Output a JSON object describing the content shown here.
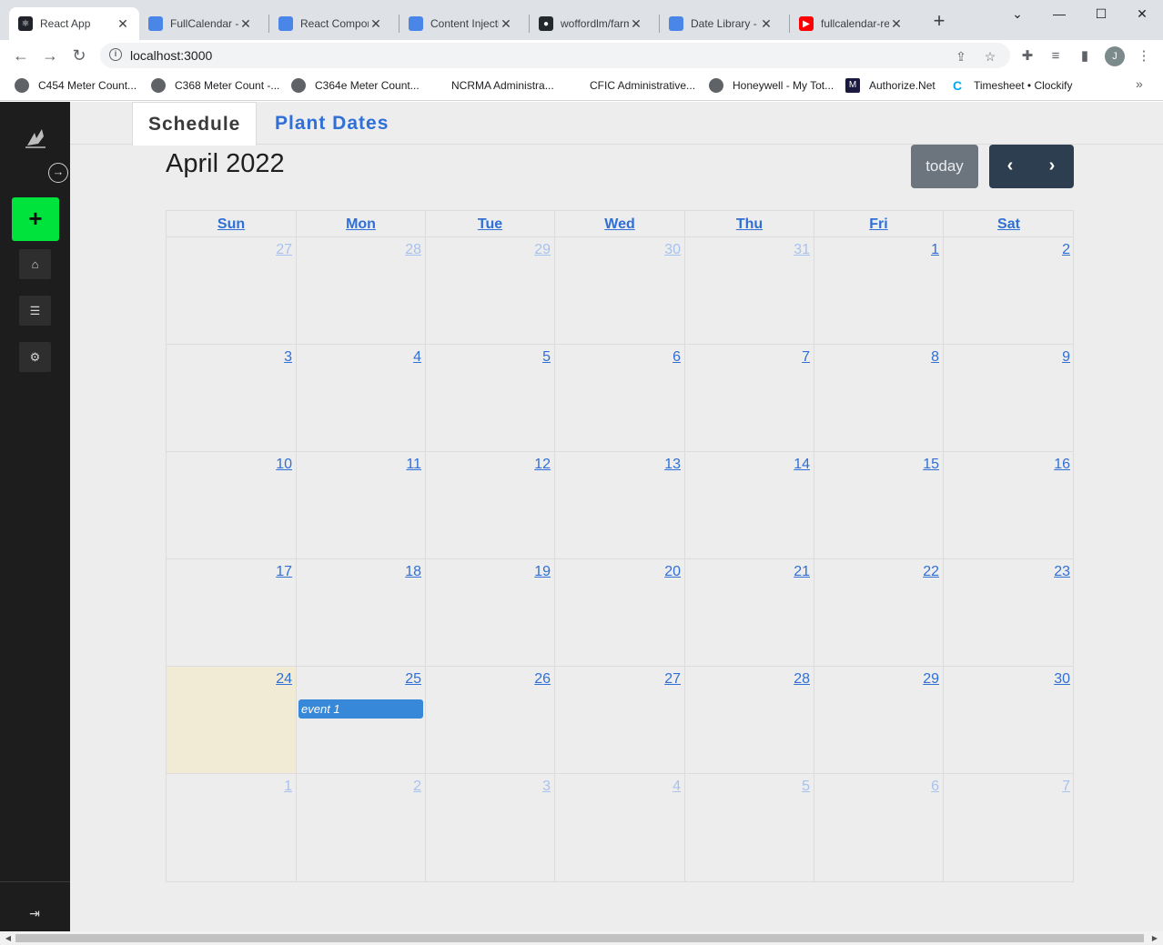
{
  "browser": {
    "tabs": [
      {
        "title": "React App",
        "icon": "react-icon",
        "active": true
      },
      {
        "title": "FullCalendar - ",
        "icon": "page-icon",
        "active": false
      },
      {
        "title": "React Compon",
        "icon": "page-icon",
        "active": false
      },
      {
        "title": "Content Injecti",
        "icon": "page-icon",
        "active": false
      },
      {
        "title": "woffordlm/farm",
        "icon": "github-icon",
        "active": false
      },
      {
        "title": "Date Library - ",
        "icon": "page-icon",
        "active": false
      },
      {
        "title": "fullcalendar-re",
        "icon": "youtube-icon",
        "active": false
      }
    ],
    "close_symbol": "✕",
    "new_tab_symbol": "+",
    "url": "localhost:3000",
    "profile_initial": "J",
    "bookmarks": [
      {
        "label": "C454 Meter Count...",
        "icon": "globe-icon"
      },
      {
        "label": "C368 Meter Count -...",
        "icon": "globe-icon"
      },
      {
        "label": "C364e Meter Count...",
        "icon": "globe-icon"
      },
      {
        "label": "NCRMA Administra...",
        "icon": "none"
      },
      {
        "label": "CFIC Administrative...",
        "icon": "none"
      },
      {
        "label": "Honeywell - My Tot...",
        "icon": "globe-icon"
      },
      {
        "label": "Authorize.Net",
        "icon": "authorize-net-icon"
      },
      {
        "label": "Timesheet • Clockify",
        "icon": "clockify-icon"
      }
    ]
  },
  "app": {
    "view_tabs": {
      "schedule": "Schedule",
      "plant_dates": "Plant Dates"
    },
    "add_symbol": "+",
    "calendar": {
      "title": "April 2022",
      "today_label": "today",
      "prev_symbol": "‹",
      "next_symbol": "›",
      "days_of_week": [
        "Sun",
        "Mon",
        "Tue",
        "Wed",
        "Thu",
        "Fri",
        "Sat"
      ],
      "weeks": [
        [
          {
            "d": "27",
            "other": true
          },
          {
            "d": "28",
            "other": true
          },
          {
            "d": "29",
            "other": true
          },
          {
            "d": "30",
            "other": true
          },
          {
            "d": "31",
            "other": true
          },
          {
            "d": "1"
          },
          {
            "d": "2"
          }
        ],
        [
          {
            "d": "3"
          },
          {
            "d": "4"
          },
          {
            "d": "5"
          },
          {
            "d": "6"
          },
          {
            "d": "7"
          },
          {
            "d": "8"
          },
          {
            "d": "9"
          }
        ],
        [
          {
            "d": "10"
          },
          {
            "d": "11"
          },
          {
            "d": "12"
          },
          {
            "d": "13"
          },
          {
            "d": "14"
          },
          {
            "d": "15"
          },
          {
            "d": "16"
          }
        ],
        [
          {
            "d": "17"
          },
          {
            "d": "18"
          },
          {
            "d": "19"
          },
          {
            "d": "20"
          },
          {
            "d": "21"
          },
          {
            "d": "22"
          },
          {
            "d": "23"
          }
        ],
        [
          {
            "d": "24",
            "today": true
          },
          {
            "d": "25",
            "event": "event 1"
          },
          {
            "d": "26"
          },
          {
            "d": "27"
          },
          {
            "d": "28"
          },
          {
            "d": "29"
          },
          {
            "d": "30"
          }
        ],
        [
          {
            "d": "1",
            "other": true
          },
          {
            "d": "2",
            "other": true
          },
          {
            "d": "3",
            "other": true
          },
          {
            "d": "4",
            "other": true
          },
          {
            "d": "5",
            "other": true
          },
          {
            "d": "6",
            "other": true
          },
          {
            "d": "7",
            "other": true
          }
        ]
      ]
    }
  },
  "colors": {
    "accent_green": "#00e33c",
    "link_blue": "#2f6fd6",
    "event_blue": "#3788d8",
    "today_highlight": "#f1ebd5",
    "sidebar": "#1d1d1d",
    "nav_button": "#2c3e50"
  }
}
